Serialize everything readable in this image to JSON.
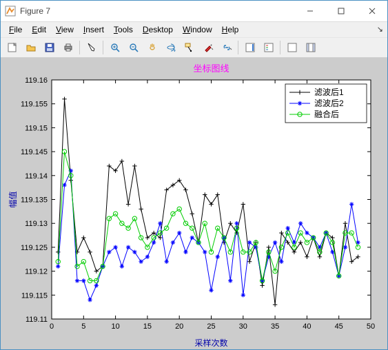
{
  "window": {
    "title": "Figure 7"
  },
  "menu": [
    {
      "u": "F",
      "r": "ile"
    },
    {
      "u": "E",
      "r": "dit"
    },
    {
      "u": "V",
      "r": "iew"
    },
    {
      "u": "I",
      "r": "nsert"
    },
    {
      "u": "T",
      "r": "ools"
    },
    {
      "u": "D",
      "r": "esktop"
    },
    {
      "u": "W",
      "r": "indow"
    },
    {
      "u": "H",
      "r": "elp"
    }
  ],
  "chart_data": {
    "type": "line",
    "title": "坐标图线",
    "title_color": "#ff00ff",
    "xlabel": "采样次数",
    "ylabel": "幅值",
    "xlim": [
      0,
      50
    ],
    "ylim": [
      119.11,
      119.16
    ],
    "xticks": [
      0,
      5,
      10,
      15,
      20,
      25,
      30,
      35,
      40,
      45,
      50
    ],
    "yticks": [
      119.11,
      119.115,
      119.12,
      119.125,
      119.13,
      119.135,
      119.14,
      119.145,
      119.15,
      119.155,
      119.16
    ],
    "x": [
      1,
      2,
      3,
      4,
      5,
      6,
      7,
      8,
      9,
      10,
      11,
      12,
      13,
      14,
      15,
      16,
      17,
      18,
      19,
      20,
      21,
      22,
      23,
      24,
      25,
      26,
      27,
      28,
      29,
      30,
      31,
      32,
      33,
      34,
      35,
      36,
      37,
      38,
      39,
      40,
      41,
      42,
      43,
      44,
      45,
      46,
      47,
      48
    ],
    "series": [
      {
        "name": "滤波后1",
        "color": "#000000",
        "marker": "plus",
        "values": [
          119.124,
          119.156,
          119.139,
          119.124,
          119.127,
          119.124,
          119.12,
          119.121,
          119.142,
          119.141,
          119.143,
          119.134,
          119.142,
          119.133,
          119.127,
          119.128,
          119.127,
          119.137,
          119.138,
          119.139,
          119.137,
          119.132,
          119.126,
          119.136,
          119.134,
          119.136,
          119.126,
          119.13,
          119.128,
          119.134,
          119.122,
          119.126,
          119.117,
          119.125,
          119.113,
          119.128,
          119.126,
          119.124,
          119.126,
          119.123,
          119.127,
          119.123,
          119.128,
          119.127,
          119.119,
          119.13,
          119.122,
          119.123
        ]
      },
      {
        "name": "滤波后2",
        "color": "#0000ff",
        "marker": "star",
        "values": [
          119.121,
          119.138,
          119.141,
          119.118,
          119.118,
          119.114,
          119.117,
          119.121,
          119.124,
          119.125,
          119.121,
          119.125,
          119.124,
          119.122,
          119.123,
          119.126,
          119.13,
          119.122,
          119.126,
          119.128,
          119.124,
          119.127,
          119.126,
          119.124,
          119.116,
          119.123,
          119.127,
          119.118,
          119.13,
          119.115,
          119.126,
          119.125,
          119.118,
          119.123,
          119.126,
          119.122,
          119.129,
          119.126,
          119.13,
          119.128,
          119.127,
          119.125,
          119.128,
          119.124,
          119.119,
          119.125,
          119.134,
          119.126
        ]
      },
      {
        "name": "融合后",
        "color": "#00cc00",
        "marker": "circle",
        "values": [
          119.122,
          119.145,
          119.14,
          119.121,
          119.122,
          119.118,
          119.118,
          119.121,
          119.131,
          119.132,
          119.13,
          119.129,
          119.131,
          119.127,
          119.125,
          119.127,
          119.128,
          119.129,
          119.132,
          119.133,
          119.13,
          119.129,
          119.126,
          119.13,
          119.124,
          119.129,
          119.127,
          119.124,
          119.129,
          119.124,
          119.124,
          119.126,
          119.118,
          119.124,
          119.12,
          119.125,
          119.128,
          119.125,
          119.128,
          119.126,
          119.127,
          119.124,
          119.128,
          119.126,
          119.119,
          119.128,
          119.128,
          119.125
        ]
      }
    ],
    "legend_position": "top-right"
  }
}
